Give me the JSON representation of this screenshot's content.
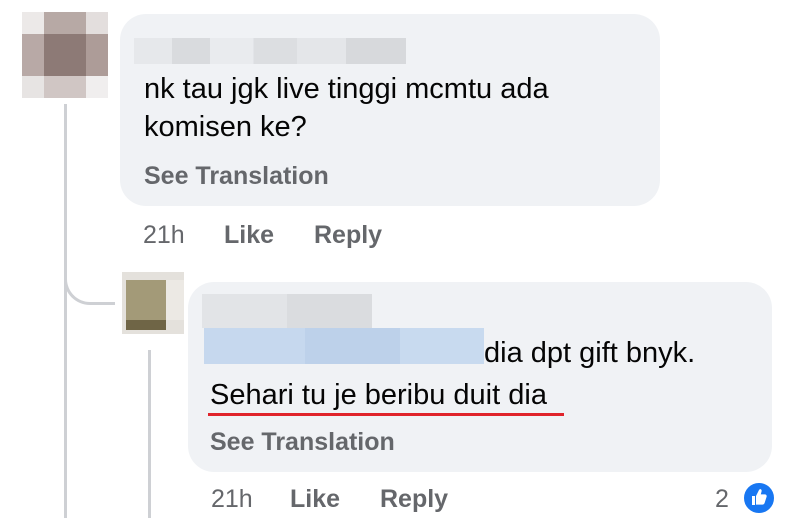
{
  "comment": {
    "text_line1": "nk tau jgk live tinggi mcmtu ada",
    "text_line2": "komisen ke?",
    "see_translation": "See Translation",
    "time": "21h",
    "like_label": "Like",
    "reply_label": "Reply"
  },
  "reply": {
    "text_line1": "dia dpt gift bnyk.",
    "text_line2_underlined": "Sehari tu je beribu duit",
    "text_line2_rest": " dia",
    "see_translation": "See Translation",
    "time": "21h",
    "like_label": "Like",
    "reply_label": "Reply",
    "reaction_count": "2",
    "reaction_icon": "thumbs-up-icon",
    "reaction_color": "#1877f2",
    "underline_color": "#e0242b"
  }
}
